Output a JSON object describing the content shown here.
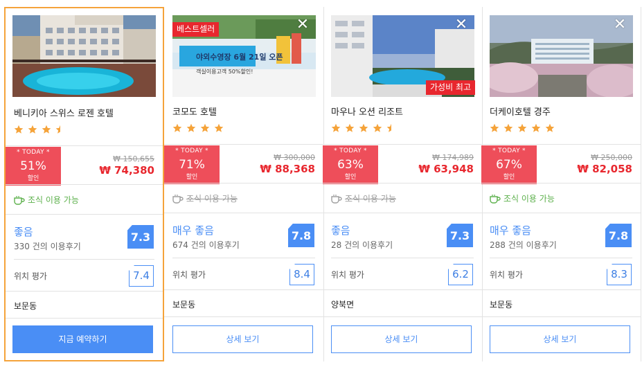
{
  "colors": {
    "accent": "#4a8ef5",
    "deal": "#ee4e5a",
    "price": "#e8272e",
    "selected_border": "#f5a33a",
    "breakfast_available": "#5cb04b",
    "star": "#f5a33a"
  },
  "hotels": [
    {
      "name": "베니키아 스위스 로젠 호텔",
      "stars": 3.5,
      "badges": [],
      "today_label": "* TODAY *",
      "discount": "51%",
      "discount_label": "할인",
      "original_price": "₩ 150,655",
      "price": "₩ 74,380",
      "breakfast": "조식 이용 가능",
      "breakfast_available": true,
      "rating_word": "좋음",
      "reviews": "330 건의 이용후기",
      "score": "7.3",
      "location_label": "위치 평가",
      "location_score": "7.4",
      "area": "보문동",
      "button": "지금 예약하기",
      "selected": true
    },
    {
      "name": "코모도 호텔",
      "stars": 4,
      "badges": [
        "베스트셀러"
      ],
      "photo_text_1": "야외수영장 6월 21일 오픈",
      "photo_text_2": "객실이용고객 50%할인!",
      "today_label": "* TODAY *",
      "discount": "71%",
      "discount_label": "할인",
      "original_price": "₩ 300,000",
      "price": "₩ 88,368",
      "breakfast": "조식 이용 가능",
      "breakfast_available": false,
      "rating_word": "매우 좋음",
      "reviews": "674 건의 이용후기",
      "score": "7.8",
      "location_label": "위치 평가",
      "location_score": "8.4",
      "area": "보문동",
      "button": "상세 보기",
      "selected": false
    },
    {
      "name": "마우나 오션 리조트",
      "stars": 4.5,
      "badges": [
        "가성비 최고"
      ],
      "today_label": "* TODAY *",
      "discount": "63%",
      "discount_label": "할인",
      "original_price": "₩ 174,989",
      "price": "₩ 63,948",
      "breakfast": "조식 이용 가능",
      "breakfast_available": false,
      "rating_word": "좋음",
      "reviews": "28 건의 이용후기",
      "score": "7.3",
      "location_label": "위치 평가",
      "location_score": "6.2",
      "area": "양북면",
      "button": "상세 보기",
      "selected": false
    },
    {
      "name": "더케이호텔 경주",
      "stars": 5,
      "badges": [],
      "today_label": "* TODAY *",
      "discount": "67%",
      "discount_label": "할인",
      "original_price": "₩ 250,000",
      "price": "₩ 82,058",
      "breakfast": "조식 이용 가능",
      "breakfast_available": true,
      "rating_word": "매우 좋음",
      "reviews": "288 건의 이용후기",
      "score": "7.8",
      "location_label": "위치 평가",
      "location_score": "8.3",
      "area": "보문동",
      "button": "상세 보기",
      "selected": false
    }
  ]
}
